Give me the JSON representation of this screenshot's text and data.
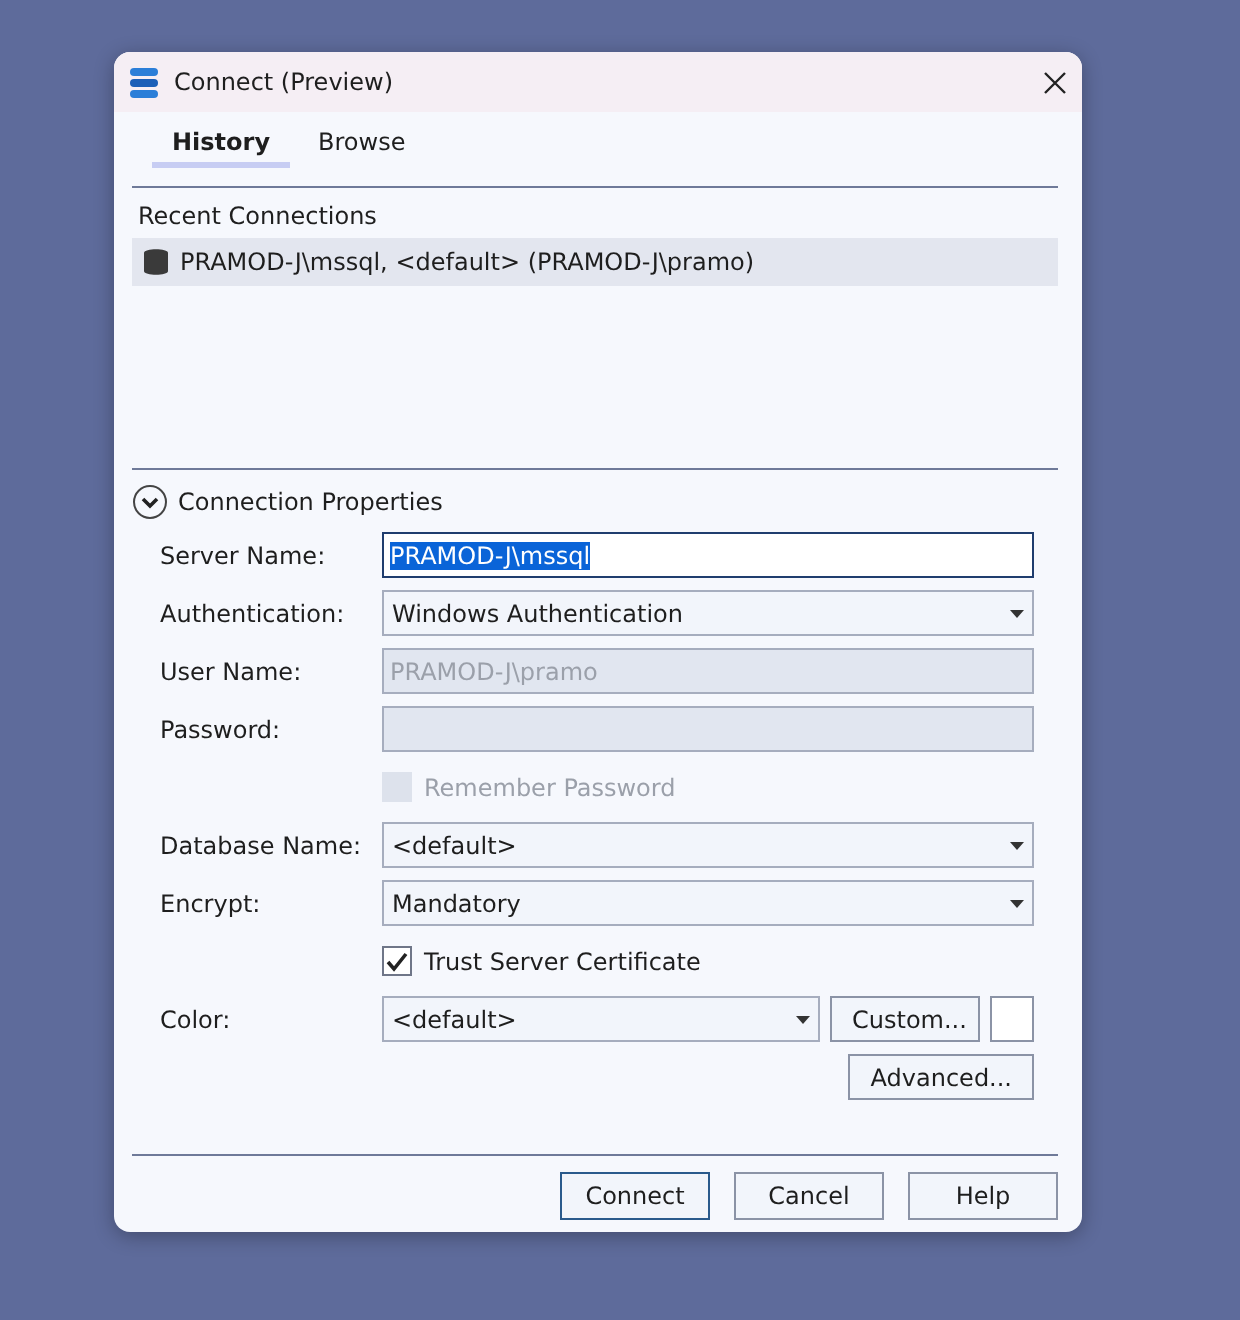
{
  "window": {
    "title": "Connect (Preview)"
  },
  "tabs": [
    {
      "label": "History",
      "selected": true
    },
    {
      "label": "Browse",
      "selected": false
    }
  ],
  "recent": {
    "heading": "Recent Connections",
    "items": [
      {
        "label": "PRAMOD-J\\mssql, <default> (PRAMOD-J\\pramo)",
        "selected": true
      }
    ]
  },
  "properties": {
    "heading": "Connection Properties",
    "expanded": true,
    "rows": [
      {
        "kind": "text",
        "label": "Server Name:",
        "value": "PRAMOD-J\\mssql",
        "focused": true,
        "disabled": false
      },
      {
        "kind": "dropdown",
        "label": "Authentication:",
        "value": "Windows Authentication"
      },
      {
        "kind": "text",
        "label": "User Name:",
        "value": "PRAMOD-J\\pramo",
        "focused": false,
        "disabled": true
      },
      {
        "kind": "text",
        "label": "Password:",
        "focused": false,
        "disabled": true
      },
      {
        "kind": "checkbox",
        "label": "Remember Password",
        "checked": false,
        "disabled": true
      },
      {
        "kind": "dropdown",
        "label": "Database Name:",
        "value": "<default>"
      },
      {
        "kind": "dropdown",
        "label": "Encrypt:",
        "value": "Mandatory"
      },
      {
        "kind": "checkbox",
        "label": "Trust Server Certificate",
        "checked": true,
        "disabled": false
      },
      {
        "kind": "color",
        "label": "Color:",
        "value": "<default>",
        "button": "Custom..."
      }
    ],
    "advanced": "Advanced..."
  },
  "buttons": [
    {
      "label": "Connect",
      "default": true
    },
    {
      "label": "Cancel",
      "default": false
    },
    {
      "label": "Help",
      "default": false
    }
  ]
}
